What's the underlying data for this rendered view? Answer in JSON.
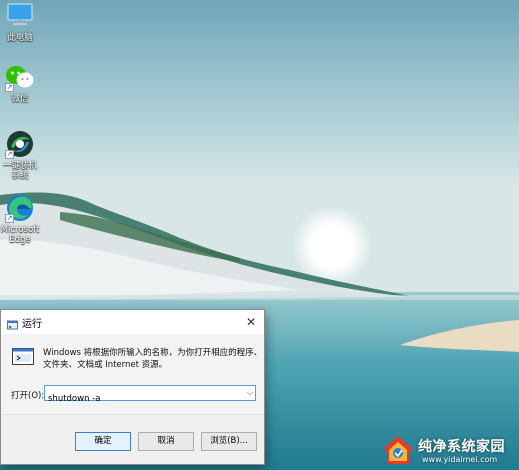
{
  "desktop": {
    "icons": [
      {
        "label": "此电脑",
        "icon": "computer-icon"
      },
      {
        "label": "微信",
        "icon": "wechat-icon"
      },
      {
        "label": "一键装机\n系统",
        "icon": "installer-icon"
      },
      {
        "label": "Microsoft\nEdge",
        "icon": "edge-icon"
      }
    ]
  },
  "run_dialog": {
    "title": "运行",
    "description": "Windows 将根据你所输入的名称，为你打开相应的程序、文件夹、文档或 Internet 资源。",
    "open_label": "打开(O):",
    "input_value": "shutdown -a",
    "buttons": {
      "ok": "确定",
      "cancel": "取消",
      "browse": "浏览(B)..."
    }
  },
  "watermark": {
    "title": "纯净系统家园",
    "url": "www.yidaimei.com"
  },
  "colors": {
    "accent": "#3c7fd0",
    "dialog_bg": "#f3f3f3",
    "wallpaper_sky": "#c7dfe3",
    "wallpaper_sea": "#2d8da0"
  }
}
